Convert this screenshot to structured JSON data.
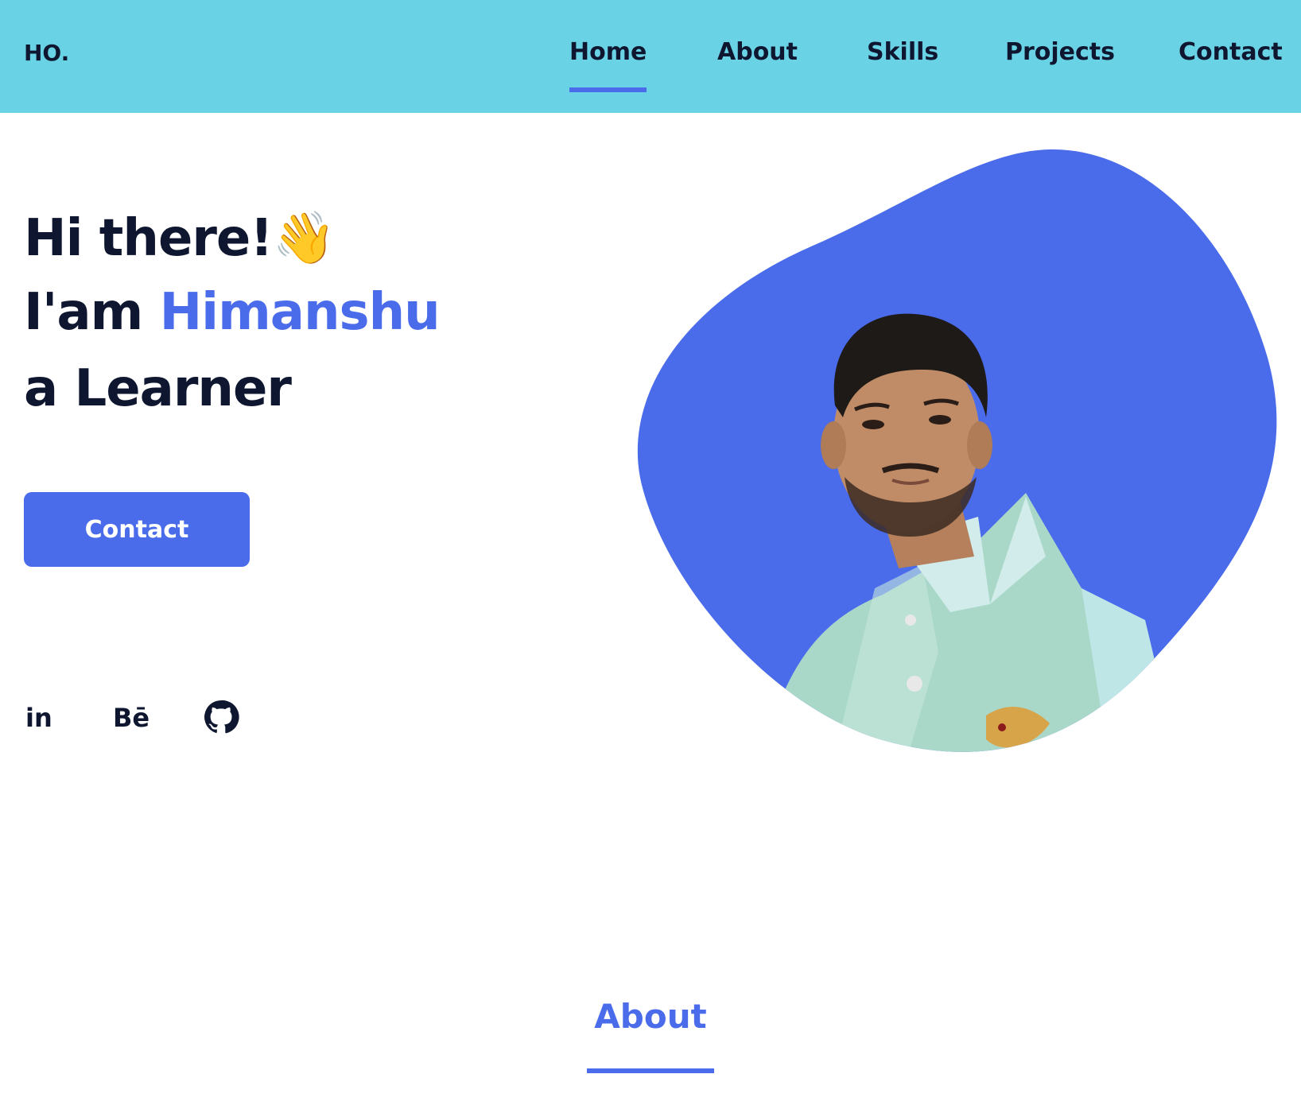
{
  "header": {
    "logo": "HO.",
    "nav": [
      {
        "label": "Home",
        "active": true
      },
      {
        "label": "About",
        "active": false
      },
      {
        "label": "Skills",
        "active": false
      },
      {
        "label": "Projects",
        "active": false
      },
      {
        "label": "Contact",
        "active": false
      }
    ]
  },
  "hero": {
    "line1": "Hi there!",
    "wave_emoji": "👋",
    "line2_prefix": "I'am ",
    "name": "Himanshu",
    "line3": "a Learner",
    "cta_label": "Contact",
    "socials": [
      {
        "icon": "linkedin-icon",
        "text": "in"
      },
      {
        "icon": "behance-icon",
        "text": "Bē"
      },
      {
        "icon": "github-icon"
      }
    ],
    "portrait_icon": "profile-photo"
  },
  "about": {
    "title": "About"
  },
  "colors": {
    "header_bg": "#69d3e5",
    "accent": "#4a6ceb",
    "text": "#0e1630",
    "background": "#ffffff"
  }
}
